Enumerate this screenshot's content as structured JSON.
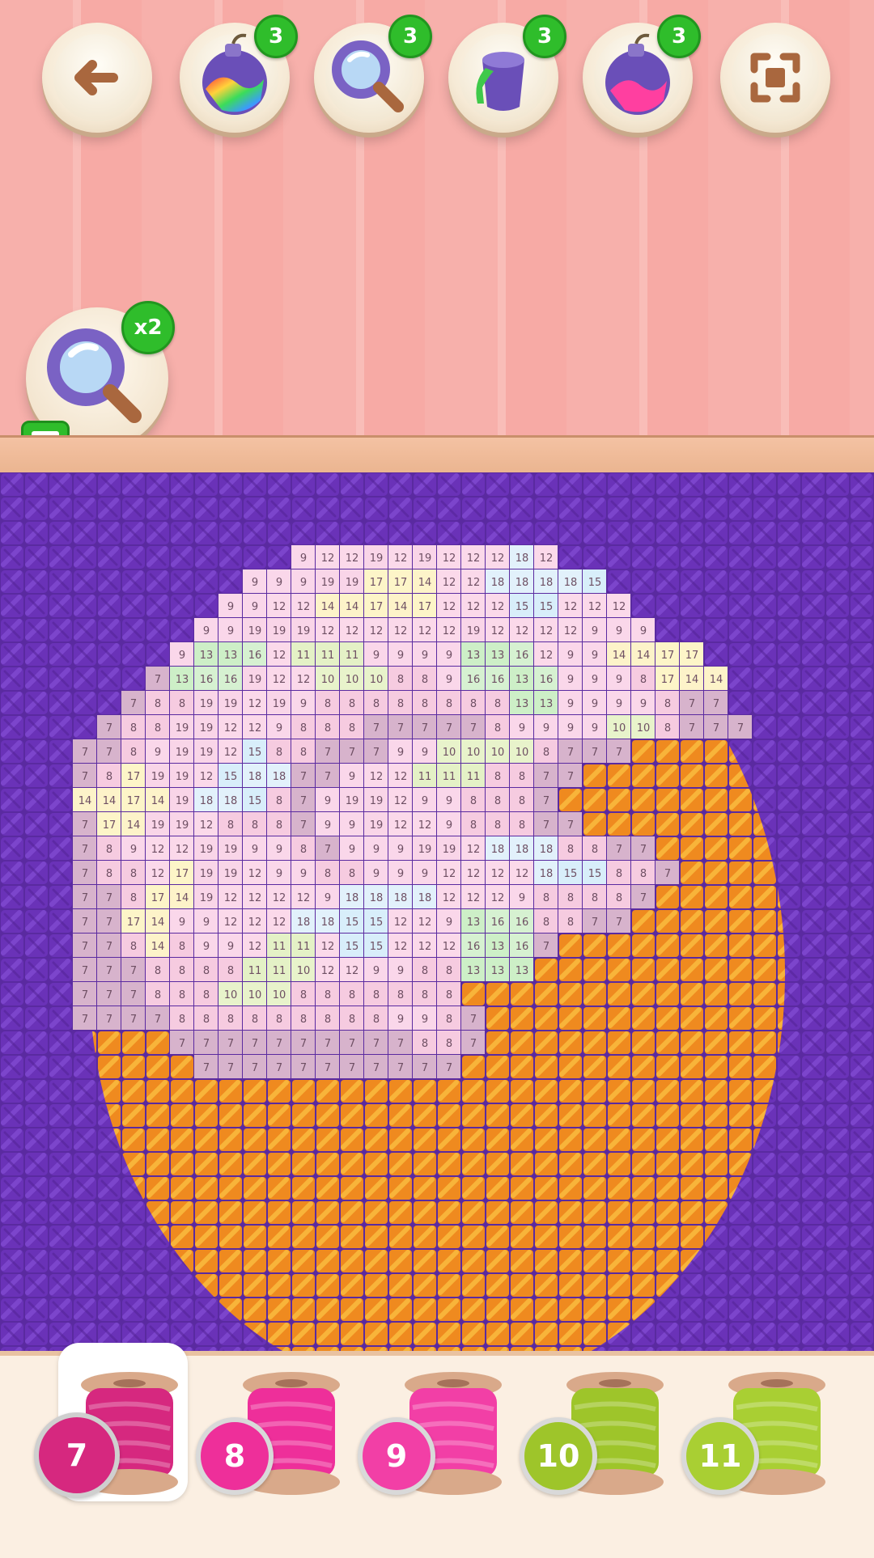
{
  "top_bar": {
    "back_label": "back",
    "boosters": [
      {
        "name": "rainbow-bomb",
        "count": "3"
      },
      {
        "name": "magnifier",
        "count": "3"
      },
      {
        "name": "paint-bucket",
        "count": "3"
      },
      {
        "name": "pink-bomb",
        "count": "3"
      }
    ],
    "fit_label": "fit"
  },
  "hint": {
    "multiplier": "x2"
  },
  "board": {
    "background_color": "#5a2aa0",
    "stitch_rows": [
      [
        "9",
        "12",
        "12",
        "19",
        "12",
        "19",
        "12",
        "12",
        "12",
        "18",
        "12"
      ],
      [
        "9",
        "9",
        "9",
        "19",
        "19",
        "17",
        "17",
        "14",
        "12",
        "12",
        "18",
        "18",
        "18",
        "18",
        "15"
      ],
      [
        "9",
        "9",
        "12",
        "12",
        "14",
        "14",
        "17",
        "14",
        "17",
        "12",
        "12",
        "12",
        "15",
        "15",
        "12",
        "12",
        "12"
      ],
      [
        "9",
        "9",
        "19",
        "19",
        "19",
        "12",
        "12",
        "12",
        "12",
        "12",
        "12",
        "19",
        "12",
        "12",
        "12",
        "12",
        "9",
        "9",
        "9"
      ],
      [
        "9",
        "13",
        "13",
        "16",
        "12",
        "11",
        "11",
        "11",
        "9",
        "9",
        "9",
        "9",
        "13",
        "13",
        "16",
        "12",
        "9",
        "9",
        "14",
        "14",
        "17",
        "17"
      ],
      [
        "7",
        "13",
        "16",
        "16",
        "19",
        "12",
        "12",
        "10",
        "10",
        "10",
        "8",
        "8",
        "9",
        "16",
        "16",
        "13",
        "16",
        "9",
        "9",
        "9",
        "8",
        "17",
        "14",
        "14"
      ],
      [
        "7",
        "8",
        "8",
        "19",
        "19",
        "12",
        "19",
        "9",
        "8",
        "8",
        "8",
        "8",
        "8",
        "8",
        "8",
        "8",
        "13",
        "13",
        "9",
        "9",
        "9",
        "9",
        "8",
        "7",
        "7"
      ],
      [
        "7",
        "8",
        "8",
        "19",
        "19",
        "12",
        "12",
        "9",
        "8",
        "8",
        "8",
        "7",
        "7",
        "7",
        "7",
        "7",
        "8",
        "9",
        "9",
        "9",
        "9",
        "10",
        "10",
        "8",
        "7",
        "7",
        "7"
      ],
      [
        "7",
        "7",
        "8",
        "9",
        "19",
        "19",
        "12",
        "15",
        "8",
        "8",
        "7",
        "7",
        "7",
        "9",
        "9",
        "10",
        "10",
        "10",
        "10",
        "8",
        "7",
        "7",
        "7"
      ],
      [
        "7",
        "8",
        "17",
        "19",
        "19",
        "12",
        "15",
        "18",
        "18",
        "7",
        "7",
        "9",
        "12",
        "12",
        "11",
        "11",
        "11",
        "8",
        "8",
        "7",
        "7"
      ],
      [
        "14",
        "14",
        "17",
        "14",
        "19",
        "18",
        "18",
        "15",
        "8",
        "7",
        "9",
        "19",
        "19",
        "12",
        "9",
        "9",
        "8",
        "8",
        "8",
        "7"
      ],
      [
        "7",
        "17",
        "14",
        "19",
        "19",
        "12",
        "8",
        "8",
        "8",
        "7",
        "9",
        "9",
        "19",
        "12",
        "12",
        "9",
        "8",
        "8",
        "8",
        "7",
        "7"
      ],
      [
        "7",
        "8",
        "9",
        "12",
        "12",
        "19",
        "19",
        "9",
        "9",
        "8",
        "7",
        "9",
        "9",
        "9",
        "19",
        "19",
        "12",
        "18",
        "18",
        "18",
        "8",
        "8",
        "7",
        "7"
      ],
      [
        "7",
        "8",
        "8",
        "12",
        "17",
        "19",
        "19",
        "12",
        "9",
        "9",
        "8",
        "8",
        "9",
        "9",
        "9",
        "12",
        "12",
        "12",
        "12",
        "18",
        "15",
        "15",
        "8",
        "8",
        "7"
      ],
      [
        "7",
        "7",
        "8",
        "17",
        "14",
        "19",
        "12",
        "12",
        "12",
        "12",
        "9",
        "18",
        "18",
        "18",
        "18",
        "12",
        "12",
        "12",
        "9",
        "8",
        "8",
        "8",
        "8",
        "7"
      ],
      [
        "7",
        "7",
        "17",
        "14",
        "9",
        "9",
        "12",
        "12",
        "12",
        "18",
        "18",
        "15",
        "15",
        "12",
        "12",
        "9",
        "13",
        "16",
        "16",
        "8",
        "8",
        "7",
        "7"
      ],
      [
        "7",
        "7",
        "8",
        "14",
        "8",
        "9",
        "9",
        "12",
        "11",
        "11",
        "12",
        "15",
        "15",
        "12",
        "12",
        "12",
        "16",
        "13",
        "16",
        "7"
      ],
      [
        "7",
        "7",
        "7",
        "8",
        "8",
        "8",
        "8",
        "11",
        "11",
        "10",
        "12",
        "12",
        "9",
        "9",
        "8",
        "8",
        "13",
        "13",
        "13"
      ],
      [
        "7",
        "7",
        "7",
        "8",
        "8",
        "8",
        "10",
        "10",
        "10",
        "8",
        "8",
        "8",
        "8",
        "8",
        "8",
        "8"
      ],
      [
        "7",
        "7",
        "7",
        "7",
        "8",
        "8",
        "8",
        "8",
        "8",
        "8",
        "8",
        "8",
        "8",
        "9",
        "9",
        "8",
        "7"
      ],
      [
        "7",
        "7",
        "7",
        "7",
        "7",
        "7",
        "7",
        "7",
        "7",
        "7",
        "8",
        "8",
        "7"
      ],
      [
        "7",
        "7",
        "7",
        "7",
        "7",
        "7",
        "7",
        "7",
        "7",
        "7",
        "7"
      ]
    ]
  },
  "palette": {
    "threads": [
      {
        "number": "7",
        "color": "#d6287f",
        "selected": true
      },
      {
        "number": "8",
        "color": "#ee2f9a",
        "selected": false
      },
      {
        "number": "9",
        "color": "#f23fa6",
        "selected": false
      },
      {
        "number": "10",
        "color": "#9ec52a",
        "selected": false
      },
      {
        "number": "11",
        "color": "#a9cf33",
        "selected": false
      }
    ]
  }
}
